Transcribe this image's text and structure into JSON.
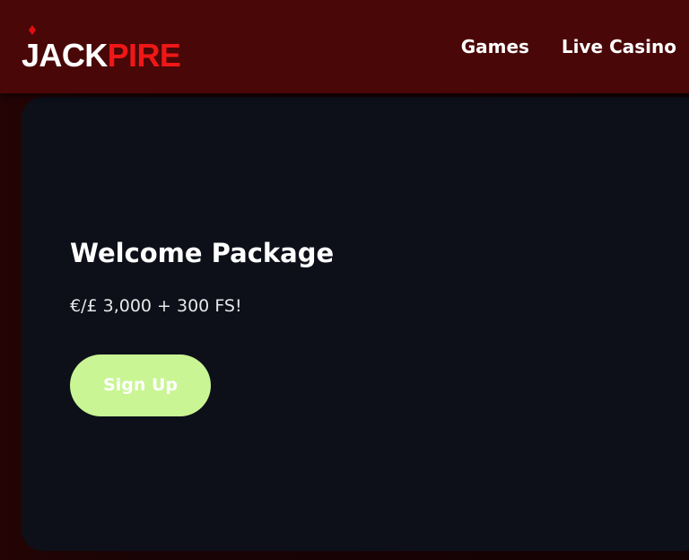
{
  "header": {
    "logo": {
      "part1": "JACK",
      "part2": "PIRE",
      "part1_color": "#ffffff",
      "part2_color": "#ef1717",
      "diamond_icon": "diamond-icon"
    },
    "nav": [
      {
        "label": "Games"
      },
      {
        "label": "Live Casino"
      }
    ],
    "background_color": "#4a0707"
  },
  "hero": {
    "title": "Welcome Package",
    "subtitle": "€/£ 3,000 + 300 FS!",
    "cta_label": "Sign Up",
    "cta_color": "#c9f594",
    "background_color": "#0d1019"
  }
}
